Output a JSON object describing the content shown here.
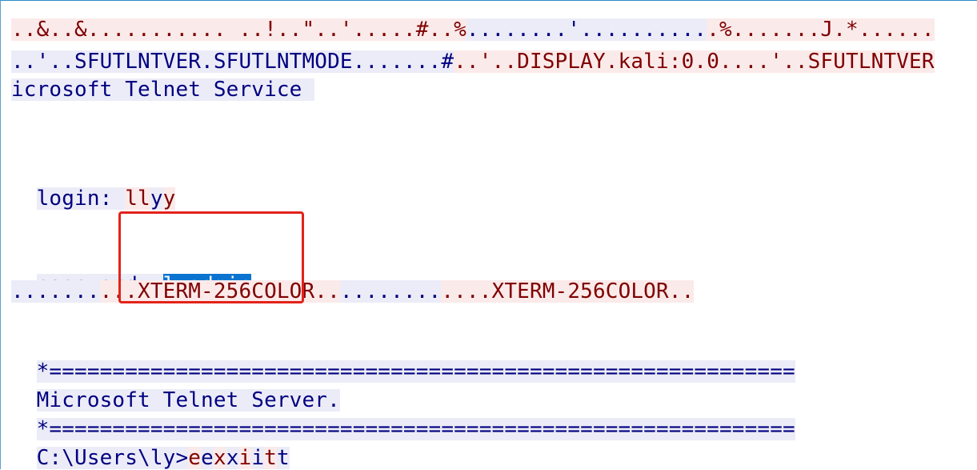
{
  "stream": {
    "line1": [
      {
        "dir": "s",
        "text": "..&..&........... ..!..\"..'.....#..%"
      },
      {
        "dir": "c",
        "text": "........'.........."
      },
      {
        "dir": "s",
        "text": ".%.......J.*......"
      }
    ],
    "line2": [
      {
        "dir": "c",
        "text": "..'..SFUTLNTVER.SFUTLNTMODE.......#"
      },
      {
        "dir": "s",
        "text": "..'..DISPLAY.kali:0.0....'..SFUTLNTVER"
      }
    ],
    "line3": [
      {
        "dir": "c",
        "text": "icrosoft Telnet Service "
      }
    ],
    "login": {
      "prompt": "login: ",
      "echo": [
        {
          "dir": "s",
          "text": "ll"
        },
        {
          "dir": "c",
          "text": "y"
        },
        {
          "dir": "s",
          "text": "y"
        }
      ]
    },
    "password": {
      "prompt": "password: ",
      "value": "lyadmin"
    },
    "term_line": [
      {
        "dir": "c",
        "text": "......."
      },
      {
        "dir": "s",
        "text": "...XTERM-256COLOR.."
      },
      {
        "dir": "c",
        "text": "........"
      },
      {
        "dir": "s",
        "text": "....XTERM-256COLOR.."
      }
    ],
    "banner_sep_1": "*===========================================================",
    "banner_text": "Microsoft Telnet Server.",
    "banner_sep_2": "*===========================================================",
    "prompt_line": {
      "prompt": "C:\\Users\\ly>",
      "echo": [
        {
          "dir": "s",
          "text": "e"
        },
        {
          "dir": "c",
          "text": "e"
        },
        {
          "dir": "s",
          "text": "x"
        },
        {
          "dir": "c",
          "text": "x"
        },
        {
          "dir": "s",
          "text": "i"
        },
        {
          "dir": "c",
          "text": "i"
        },
        {
          "dir": "s",
          "text": "t"
        },
        {
          "dir": "c",
          "text": "t"
        }
      ]
    }
  },
  "colors": {
    "client_text": "#000080",
    "server_text": "#800000",
    "selection": "#0a74d0",
    "annotation_box": "#e2231a"
  }
}
